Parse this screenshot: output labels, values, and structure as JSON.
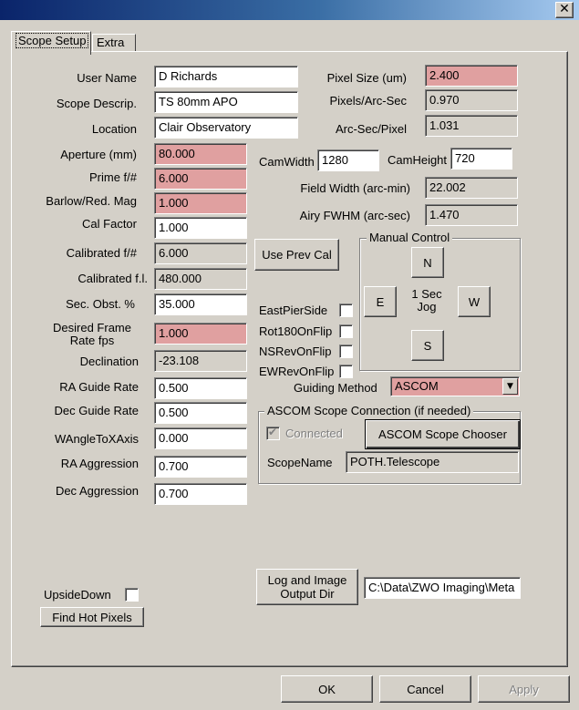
{
  "window": {
    "close_glyph": "✕"
  },
  "tabs": [
    {
      "label": "Scope Setup",
      "active": true
    },
    {
      "label": "Extra",
      "active": false
    }
  ],
  "left_fields": {
    "user_name": {
      "label": "User Name",
      "value": "D Richards"
    },
    "scope_descrip": {
      "label": "Scope Descrip.",
      "value": "TS 80mm APO"
    },
    "location": {
      "label": "Location",
      "value": "Clair Observatory"
    },
    "aperture": {
      "label": "Aperture (mm)",
      "value": "80.000"
    },
    "prime_f": {
      "label": "Prime f/#",
      "value": "6.000"
    },
    "barlow": {
      "label": "Barlow/Red. Mag",
      "value": "1.000"
    },
    "cal_factor": {
      "label": "Cal Factor",
      "value": "1.000"
    },
    "calibrated_f": {
      "label": "Calibrated f/#",
      "value": "6.000"
    },
    "calibrated_fl": {
      "label": "Calibrated f.l.",
      "value": "480.000"
    },
    "sec_obst": {
      "label": "Sec. Obst. %",
      "value": "35.000"
    },
    "desired_frame_rate": {
      "label": "Desired Frame Rate fps",
      "value": "1.000"
    },
    "declination": {
      "label": "Declination",
      "value": "-23.108"
    },
    "ra_guide_rate": {
      "label": "RA Guide Rate",
      "value": "0.500"
    },
    "dec_guide_rate": {
      "label": "Dec Guide Rate",
      "value": "0.500"
    },
    "wangle": {
      "label": "WAngleToXAxis",
      "value": "0.000"
    },
    "ra_aggression": {
      "label": "RA Aggression",
      "value": "0.700"
    },
    "dec_aggression": {
      "label": "Dec Aggression",
      "value": "0.700"
    }
  },
  "right_fields": {
    "pixel_size": {
      "label": "Pixel Size (um)",
      "value": "2.400"
    },
    "pixels_arcsec": {
      "label": "Pixels/Arc-Sec",
      "value": "0.970"
    },
    "arcsec_pixel": {
      "label": "Arc-Sec/Pixel",
      "value": "1.031"
    },
    "cam_width": {
      "label": "CamWidth",
      "value": "1280"
    },
    "cam_height": {
      "label": "CamHeight",
      "value": "720"
    },
    "field_width": {
      "label": "Field Width (arc-min)",
      "value": "22.002"
    },
    "airy_fwhm": {
      "label": "Airy FWHM (arc-sec)",
      "value": "1.470"
    }
  },
  "use_prev_cal_label": "Use Prev Cal",
  "manual_control": {
    "title": "Manual Control",
    "north": "N",
    "south": "S",
    "east": "E",
    "west": "W",
    "jog_label": "1 Sec Jog"
  },
  "flip_options": [
    {
      "label": "EastPierSide",
      "checked": false
    },
    {
      "label": "Rot180OnFlip",
      "checked": false
    },
    {
      "label": "NSRevOnFlip",
      "checked": false
    },
    {
      "label": "EWRevOnFlip",
      "checked": false
    }
  ],
  "guiding_method": {
    "label": "Guiding Method",
    "value": "ASCOM",
    "arrow": "▼"
  },
  "ascom": {
    "title": "ASCOM Scope Connection (if needed)",
    "connected_label": "Connected",
    "connected_checked": true,
    "check_glyph": "✔",
    "chooser_label": "ASCOM Scope Chooser",
    "scope_name_label": "ScopeName",
    "scope_name_value": "POTH.Telescope"
  },
  "upside_down_label": "UpsideDown",
  "find_hot_pixels_label": "Find Hot Pixels",
  "log_output_label": "Log and Image Output Dir",
  "log_output_path": "C:\\Data\\ZWO Imaging\\Meta",
  "footer": {
    "ok": "OK",
    "cancel": "Cancel",
    "apply": "Apply"
  }
}
